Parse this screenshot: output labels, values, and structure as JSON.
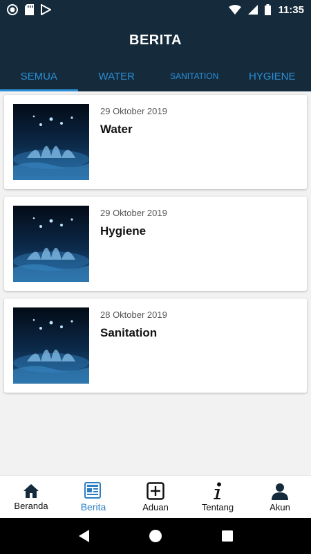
{
  "status_bar": {
    "time": "11:35"
  },
  "app_bar": {
    "title": "BERITA"
  },
  "tabs": [
    {
      "label": "SEMUA",
      "active": true
    },
    {
      "label": "WATER",
      "active": false
    },
    {
      "label": "SANITATION",
      "active": false
    },
    {
      "label": "HYGIENE",
      "active": false
    }
  ],
  "news": [
    {
      "date": "29 Oktober 2019",
      "title": "Water"
    },
    {
      "date": "29 Oktober 2019",
      "title": "Hygiene"
    },
    {
      "date": "28 Oktober 2019",
      "title": "Sanitation"
    }
  ],
  "bottom_nav": [
    {
      "label": "Beranda",
      "icon": "home-icon",
      "active": false
    },
    {
      "label": "Berita",
      "icon": "newspaper-icon",
      "active": true
    },
    {
      "label": "Aduan",
      "icon": "add-box-icon",
      "active": false
    },
    {
      "label": "Tentang",
      "icon": "info-icon",
      "active": false
    },
    {
      "label": "Akun",
      "icon": "account-icon",
      "active": false
    }
  ],
  "colors": {
    "header": "#152b3c",
    "accent": "#2a8fd6"
  }
}
